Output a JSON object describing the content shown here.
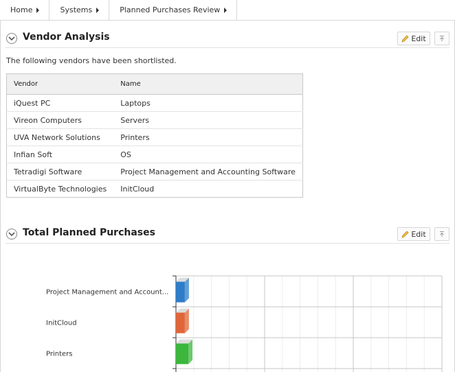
{
  "breadcrumb": [
    {
      "label": "Home"
    },
    {
      "label": "Systems"
    },
    {
      "label": "Planned Purchases Review"
    }
  ],
  "vendor_region": {
    "title": "Vendor Analysis",
    "edit_label": "Edit",
    "intro": "The following vendors have been shortlisted.",
    "columns": [
      "Vendor",
      "Name"
    ],
    "rows": [
      [
        "iQuest PC",
        "Laptops"
      ],
      [
        "Vireon Computers",
        "Servers"
      ],
      [
        "UVA Network Solutions",
        "Printers"
      ],
      [
        "Infian Soft",
        "OS"
      ],
      [
        "Tetradigi Software",
        "Project Management and Accounting Software"
      ],
      [
        "VirtualByte Technologies",
        "InitCloud"
      ]
    ]
  },
  "purchases_region": {
    "title": "Total Planned Purchases",
    "edit_label": "Edit"
  },
  "chart_data": {
    "type": "bar",
    "orientation": "horizontal",
    "categories": [
      "Project Management and Account...",
      "InitCloud",
      "Printers"
    ],
    "values": [
      1,
      1,
      1.4
    ],
    "colors": [
      "#2f7dc8",
      "#e0663a",
      "#3cb73c"
    ],
    "xlim": [
      0,
      30
    ],
    "grid": true
  },
  "colors": {
    "border": "#d4d4d4",
    "header_bg": "#f0f0f0"
  }
}
